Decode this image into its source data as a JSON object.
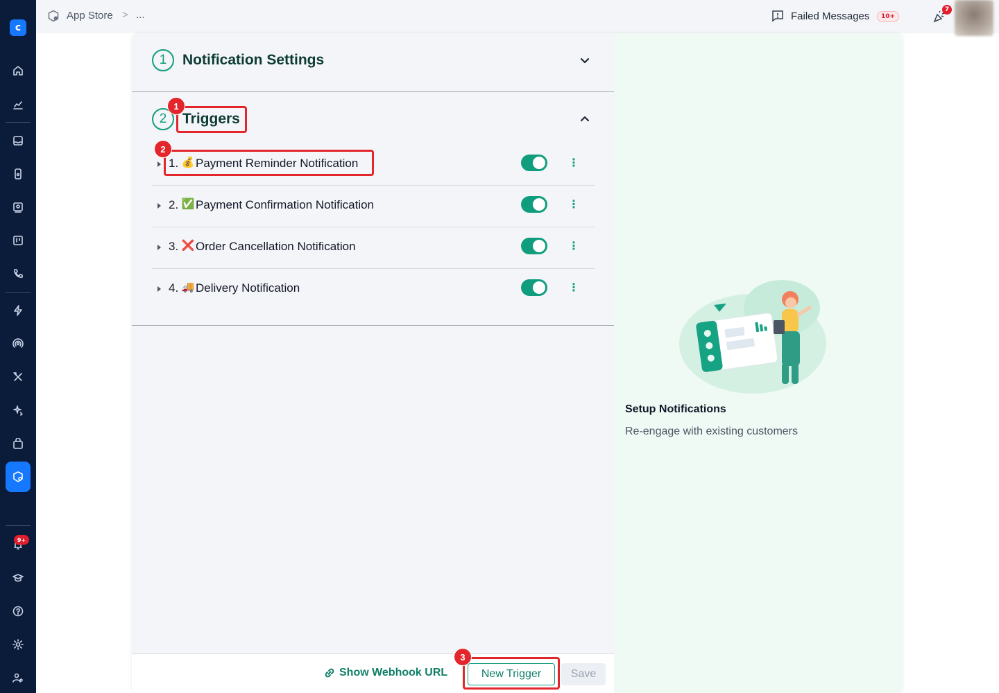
{
  "topbar": {
    "breadcrumb_app": "App Store",
    "breadcrumb_sep": ">",
    "breadcrumb_more": "...",
    "failed_messages_label": "Failed Messages",
    "failed_messages_badge": "10+",
    "notifications_badge": "7"
  },
  "sidebar": {
    "logo_glyph": "c",
    "notifications_badge": "9+",
    "active_item": "app-store-icon"
  },
  "notification_settings": {
    "step": "1",
    "title": "Notification Settings"
  },
  "triggers": {
    "step": "2",
    "title": "Triggers",
    "items": [
      {
        "num": "1.",
        "emoji": "💰",
        "label": "Payment Reminder Notification",
        "enabled": true
      },
      {
        "num": "2.",
        "emoji": "✅",
        "label": "Payment Confirmation Notification",
        "enabled": true
      },
      {
        "num": "3.",
        "emoji": "❌",
        "label": "Order Cancellation Notification",
        "enabled": true
      },
      {
        "num": "4.",
        "emoji": "🚚",
        "label": "Delivery Notification",
        "enabled": true
      }
    ]
  },
  "footer": {
    "webhook_label": "Show Webhook URL",
    "new_trigger_label": "New Trigger",
    "save_label": "Save"
  },
  "side_info": {
    "title": "Setup Notifications",
    "subtitle": "Re-engage with existing customers"
  },
  "annotations": [
    "1",
    "2",
    "3"
  ],
  "colors": {
    "sidebar_bg": "#0b1b3a",
    "accent": "#0f9d7e",
    "active_nav": "#1677ff",
    "highlight": "#e3262b"
  }
}
